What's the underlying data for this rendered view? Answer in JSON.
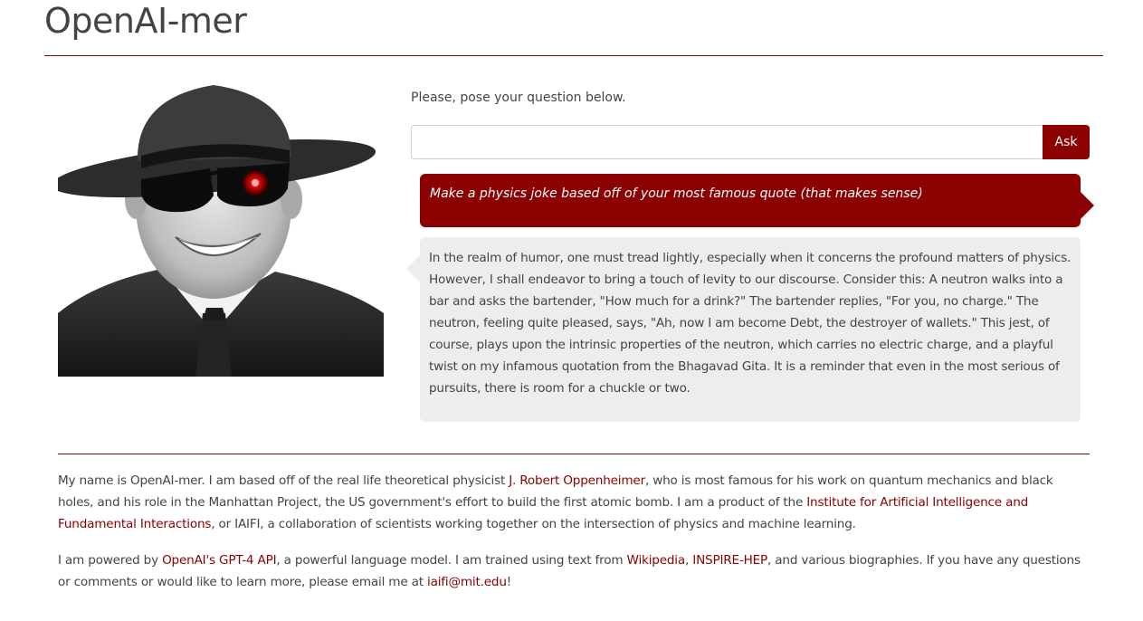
{
  "page": {
    "title": "OpenAI-mer"
  },
  "colors": {
    "accent": "#8b0000",
    "bot_bubble_bg": "#ededed",
    "text": "#444444"
  },
  "portrait": {
    "alt": "OpenAI-mer portrait",
    "icon": "avatar-portrait"
  },
  "prompt": {
    "label": "Please, pose your question below.",
    "input_value": "",
    "input_placeholder": ""
  },
  "ask_button": {
    "label": "Ask"
  },
  "chat": {
    "user_message": "Make a physics joke based off of your most famous quote (that makes sense)",
    "bot_message": "In the realm of humor, one must tread lightly, especially when it concerns the profound matters of physics. However, I shall endeavor to bring a touch of levity to our discourse. Consider this: A neutron walks into a bar and asks the bartender, \"How much for a drink?\" The bartender replies, \"For you, no charge.\" The neutron, feeling quite pleased, says, \"Ah, now I am become Debt, the destroyer of wallets.\" This jest, of course, plays upon the intrinsic properties of the neutron, which carries no electric charge, and a playful twist on my infamous quotation from the Bhagavad Gita. It is a reminder that even in the most serious of pursuits, there is room for a chuckle or two."
  },
  "about": {
    "p1_a": "My name is OpenAI-mer. I am based off of the real life theoretical physicist ",
    "link_oppenheimer": "J. Robert Oppenheimer",
    "p1_b": ", who is most famous for his work on quantum mechanics and black holes, and his role in the Manhattan Project, the US government's effort to build the first atomic bomb. I am a product of the ",
    "link_iaifi": "Institute for Artificial Intelligence and Fundamental Interactions",
    "p1_c": ", or IAIFI, a collaboration of scientists working together on the intersection of physics and machine learning.",
    "p2_a": "I am powered by ",
    "link_gpt4": "OpenAI's GPT-4 API",
    "p2_b": ", a powerful language model. I am trained using text from ",
    "link_wikipedia": "Wikipedia",
    "p2_c": ", ",
    "link_inspire": "INSPIRE-HEP",
    "p2_d": ", and various biographies. If you have any questions or comments or would like to learn more, please email me at ",
    "link_email": "iaifi@mit.edu",
    "p2_e": "!"
  }
}
